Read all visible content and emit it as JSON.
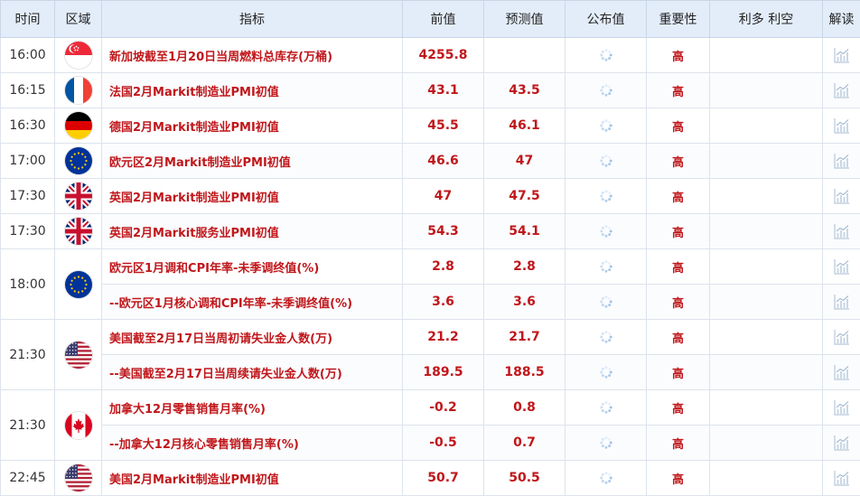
{
  "header": {
    "time": "时间",
    "region": "区域",
    "indicator": "指标",
    "previous": "前值",
    "forecast": "预测值",
    "actual": "公布值",
    "importance": "重要性",
    "impact": "利多 利空",
    "interpret": "解读"
  },
  "rows": [
    {
      "time": "16:00",
      "flag": "singapore-flag-icon",
      "indicator": "新加坡截至1月20日当周燃料总库存(万桶)",
      "previous": "4255.8",
      "forecast": "",
      "importance": "高"
    },
    {
      "time": "16:15",
      "flag": "france-flag-icon",
      "indicator": "法国2月Markit制造业PMI初值",
      "previous": "43.1",
      "forecast": "43.5",
      "importance": "高"
    },
    {
      "time": "16:30",
      "flag": "germany-flag-icon",
      "indicator": "德国2月Markit制造业PMI初值",
      "previous": "45.5",
      "forecast": "46.1",
      "importance": "高"
    },
    {
      "time": "17:00",
      "flag": "eu-flag-icon",
      "indicator": "欧元区2月Markit制造业PMI初值",
      "previous": "46.6",
      "forecast": "47",
      "importance": "高"
    },
    {
      "time": "17:30",
      "flag": "uk-flag-icon",
      "indicator": "英国2月Markit制造业PMI初值",
      "previous": "47",
      "forecast": "47.5",
      "importance": "高"
    },
    {
      "time": "17:30",
      "flag": "uk-flag-icon",
      "indicator": "英国2月Markit服务业PMI初值",
      "previous": "54.3",
      "forecast": "54.1",
      "importance": "高"
    },
    {
      "time": "18:00",
      "flag": "eu-flag-icon",
      "indicator": "欧元区1月调和CPI年率-未季调终值(%)",
      "previous": "2.8",
      "forecast": "2.8",
      "importance": "高"
    },
    {
      "indicator": "--欧元区1月核心调和CPI年率-未季调终值(%)",
      "previous": "3.6",
      "forecast": "3.6",
      "importance": "高"
    },
    {
      "time": "21:30",
      "flag": "us-flag-icon",
      "indicator": "美国截至2月17日当周初请失业金人数(万)",
      "previous": "21.2",
      "forecast": "21.7",
      "importance": "高"
    },
    {
      "indicator": "--美国截至2月17日当周续请失业金人数(万)",
      "previous": "189.5",
      "forecast": "188.5",
      "importance": "高"
    },
    {
      "time": "21:30",
      "flag": "canada-flag-icon",
      "indicator": "加拿大12月零售销售月率(%)",
      "previous": "-0.2",
      "forecast": "0.8",
      "importance": "高"
    },
    {
      "indicator": "--加拿大12月核心零售销售月率(%)",
      "previous": "-0.5",
      "forecast": "0.7",
      "importance": "高"
    },
    {
      "time": "22:45",
      "flag": "us-flag-icon",
      "indicator": "美国2月Markit制造业PMI初值",
      "previous": "50.7",
      "forecast": "50.5",
      "importance": "高"
    }
  ],
  "colors": {
    "header_bg": "#e3edfa",
    "value_red": "#c0171b",
    "border": "#dde3ec"
  }
}
